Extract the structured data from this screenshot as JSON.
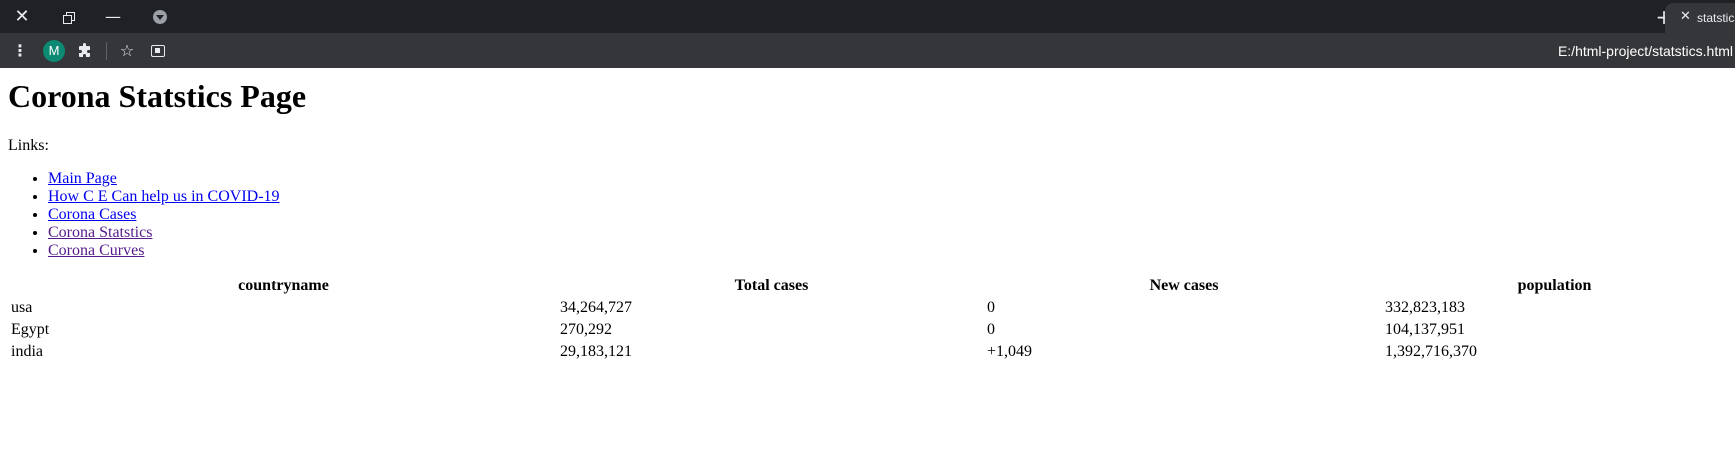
{
  "browser": {
    "tab_title": "statstics",
    "address": "E:/html-project/statstics.html",
    "profile_initial": "M",
    "icons": {
      "window_close": "close-icon",
      "window_restore": "restore-icon",
      "window_minimize": "minimize-icon",
      "tab_search": "tab-search-icon",
      "new_tab": "plus-icon",
      "tab_close": "close-icon",
      "menu": "kebab-menu-icon",
      "extensions": "puzzle-icon",
      "bookmark": "star-icon",
      "cast": "cast-icon"
    },
    "colors": {
      "titlebar": "#202124",
      "toolbar": "#35363a",
      "avatar": "#0d8a73"
    }
  },
  "page": {
    "title": "Corona Statstics Page",
    "links_label": "Links:",
    "links": [
      {
        "label": "Main Page",
        "visited": false
      },
      {
        "label": "How C E Can help us in COVID-19",
        "visited": false
      },
      {
        "label": "Corona Cases",
        "visited": false
      },
      {
        "label": "Corona Statstics",
        "visited": true
      },
      {
        "label": "Corona Curves",
        "visited": true
      }
    ],
    "link_colors": {
      "unvisited": "#0000ee",
      "visited": "#551a8b"
    },
    "table": {
      "headers": [
        "countryname",
        "Total cases",
        "New cases",
        "population"
      ],
      "rows": [
        [
          "usa",
          "34,264,727",
          "0",
          "332,823,183"
        ],
        [
          "Egypt",
          "270,292",
          "0",
          "104,137,951"
        ],
        [
          "india",
          "29,183,121",
          "+1,049",
          "1,392,716,370"
        ]
      ]
    }
  }
}
